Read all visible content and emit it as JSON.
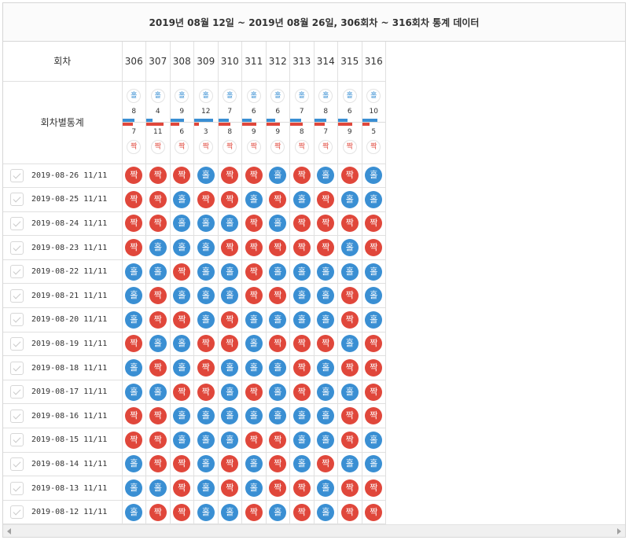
{
  "title": "2019년 08월 12일 ~ 2019년 08월 26일, 306회차 ~ 316회차 통계 데이터",
  "header": {
    "round_label": "회차",
    "stats_label": "회차별통계"
  },
  "odd_label": "홀",
  "even_label": "짝",
  "colors": {
    "odd": "#3a8fd3",
    "even": "#e0473b"
  },
  "columns": [
    {
      "round": "306",
      "odd": 8,
      "even": 7
    },
    {
      "round": "307",
      "odd": 4,
      "even": 11
    },
    {
      "round": "308",
      "odd": 9,
      "even": 6
    },
    {
      "round": "309",
      "odd": 12,
      "even": 3
    },
    {
      "round": "310",
      "odd": 7,
      "even": 8
    },
    {
      "round": "311",
      "odd": 6,
      "even": 9
    },
    {
      "round": "312",
      "odd": 6,
      "even": 9
    },
    {
      "round": "313",
      "odd": 7,
      "even": 8
    },
    {
      "round": "314",
      "odd": 8,
      "even": 7
    },
    {
      "round": "315",
      "odd": 6,
      "even": 9
    },
    {
      "round": "316",
      "odd": 10,
      "even": 5
    }
  ],
  "rows": [
    {
      "date": "2019-08-26 11/11",
      "results": "EEEOEEOEOEO"
    },
    {
      "date": "2019-08-25 11/11",
      "results": "EEOEEOEOEOO"
    },
    {
      "date": "2019-08-24 11/11",
      "results": "EEOOOEOEEEE"
    },
    {
      "date": "2019-08-23 11/11",
      "results": "EOOOEEEEEOE"
    },
    {
      "date": "2019-08-22 11/11",
      "results": "OOEOOEOOOOO"
    },
    {
      "date": "2019-08-21 11/11",
      "results": "OEOOOEEOOEO"
    },
    {
      "date": "2019-08-20 11/11",
      "results": "OEEOEOOOOEO"
    },
    {
      "date": "2019-08-19 11/11",
      "results": "EOOEEOEEEOE"
    },
    {
      "date": "2019-08-18 11/11",
      "results": "OEOEOOOEOEE"
    },
    {
      "date": "2019-08-17 11/11",
      "results": "OOEEOEOEOOE"
    },
    {
      "date": "2019-08-16 11/11",
      "results": "EEOOOOOOOEE"
    },
    {
      "date": "2019-08-15 11/11",
      "results": "EEOOOEEOOEO"
    },
    {
      "date": "2019-08-14 11/11",
      "results": "OEEOEOEOEOO"
    },
    {
      "date": "2019-08-13 11/11",
      "results": "OOEOEOEEOEE"
    },
    {
      "date": "2019-08-12 11/11",
      "results": "OEEOOEOEOEE"
    }
  ]
}
